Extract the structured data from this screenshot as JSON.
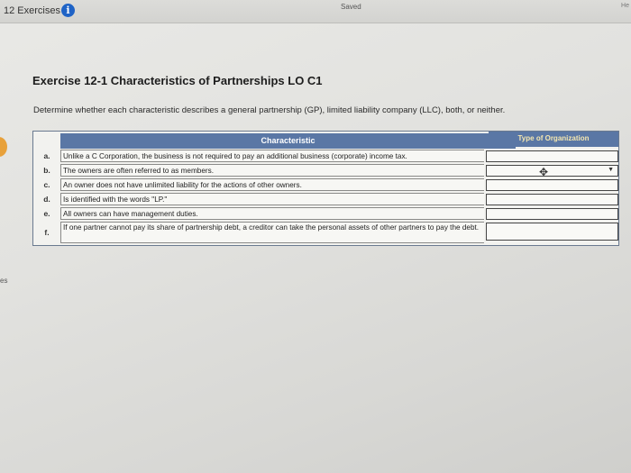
{
  "topbar": {
    "title": "12 Exercises",
    "info_icon": "i",
    "saved": "Saved",
    "right_edge": "He"
  },
  "left_mark": "es",
  "exercise": {
    "title": "Exercise 12-1 Characteristics of Partnerships LO C1",
    "prompt": "Determine whether each characteristic describes a general partnership (GP), limited liability company (LLC), both, or neither."
  },
  "table": {
    "header_characteristic": "Characteristic",
    "header_type": "Type of Organization",
    "rows": [
      {
        "letter": "a.",
        "text": "Unlike a C Corporation, the business is not required to pay an additional business (corporate) income tax."
      },
      {
        "letter": "b.",
        "text": "The owners are often referred to as members."
      },
      {
        "letter": "c.",
        "text": "An owner does not have unlimited liability for the actions of other owners."
      },
      {
        "letter": "d.",
        "text": "Is identified with the words \"LP.\""
      },
      {
        "letter": "e.",
        "text": "All owners can have management duties."
      },
      {
        "letter": "f.",
        "text": "If one partner cannot pay its share of partnership debt, a creditor can take the personal assets of other partners to pay the debt."
      }
    ]
  },
  "icons": {
    "cursor": "✥",
    "caret": "▼"
  }
}
